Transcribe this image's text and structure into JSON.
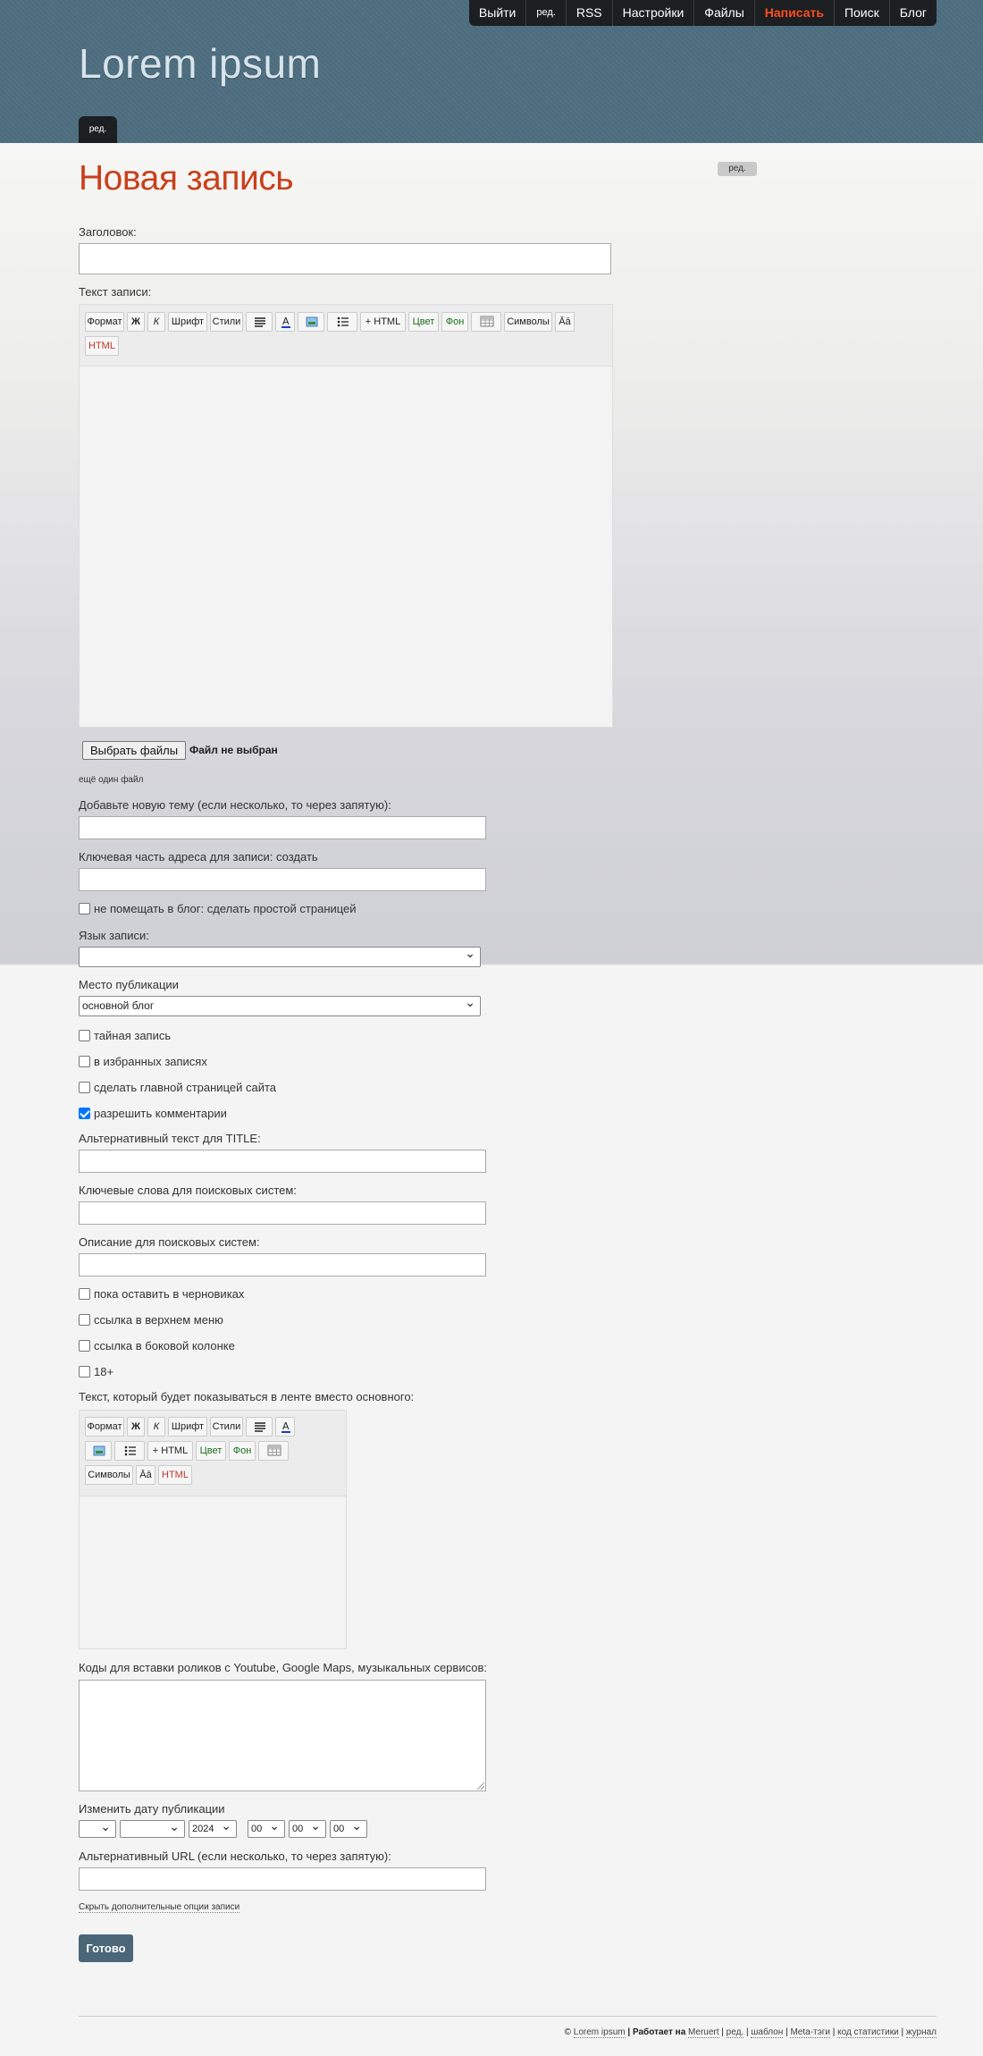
{
  "site": {
    "title": "Lorem ipsum",
    "edit_tab": "ред."
  },
  "topnav": [
    {
      "label": "Выйти"
    },
    {
      "label": "ред."
    },
    {
      "label": "RSS"
    },
    {
      "label": "Настройки"
    },
    {
      "label": "Файлы"
    },
    {
      "label": "Написать",
      "active": true
    },
    {
      "label": "Поиск"
    },
    {
      "label": "Блог"
    }
  ],
  "sidebar": {
    "edit_label": "ред."
  },
  "page": {
    "heading": "Новая запись"
  },
  "form": {
    "title_label": "Заголовок:",
    "text_label": "Текст записи:",
    "toolbar1": {
      "format": "Формат",
      "bold": "Ж",
      "italic": "К",
      "font": "Шрифт",
      "styles": "Стили",
      "html_plus": "+ HTML",
      "color": "Цвет",
      "bg": "Фон",
      "symbols": "Символы",
      "case": "Āā",
      "html": "HTML"
    },
    "file_button": "Выбрать файлы",
    "file_status": "Файл не выбран",
    "more_file": "ещё один файл",
    "tags_label": "Добавьте новую тему (если несколько, то через запятую):",
    "slug_label": "Ключевая часть адреса для записи: создать",
    "simple_page": "не помещать в блог: сделать простой страницей",
    "lang_label": "Язык записи:",
    "lang_value": "",
    "place_label": "Место публикации",
    "place_value": "основной блог",
    "secret": "тайная запись",
    "favorites": "в избранных записях",
    "homepage": "сделать главной страницей сайта",
    "comments": "разрешить комментарии",
    "comments_checked": true,
    "alt_title_label": "Альтернативный текст для TITLE:",
    "keywords_label": "Ключевые слова для поисковых систем:",
    "desc_label": "Описание для поисковых систем:",
    "draft": "пока оставить в черновиках",
    "top_menu": "ссылка в верхнем меню",
    "side_column": "ссылка в боковой колонке",
    "adult": "18+",
    "feed_text_label": "Текст, который будет показываться в ленте вместо основного:",
    "embed_label": "Коды для вставки роликов с Youtube, Google Maps, музыкальных сервисов:",
    "date_label": "Изменить дату публикации",
    "date": {
      "day": "",
      "month": "",
      "year": "2024",
      "hour": "00",
      "min": "00",
      "sec": "00"
    },
    "alt_url_label": "Альтернативный URL (если несколько, то через запятую):",
    "hide_options": "Скрыть дополнительные опции записи",
    "submit": "Готово"
  },
  "footer": {
    "copyright": "©",
    "site": "Lorem ipsum",
    "powered": "| Работает на",
    "engine": "Meruert",
    "sep": "|",
    "edit": "ред.",
    "template": "шаблон",
    "meta": "Meta-тэги",
    "stats": "код статистики",
    "journal": "журнал"
  },
  "colors": {
    "header_bg": "#4e6e80",
    "accent": "#c8401b",
    "nav_active": "#ff4b1f",
    "button": "#4a6677"
  }
}
